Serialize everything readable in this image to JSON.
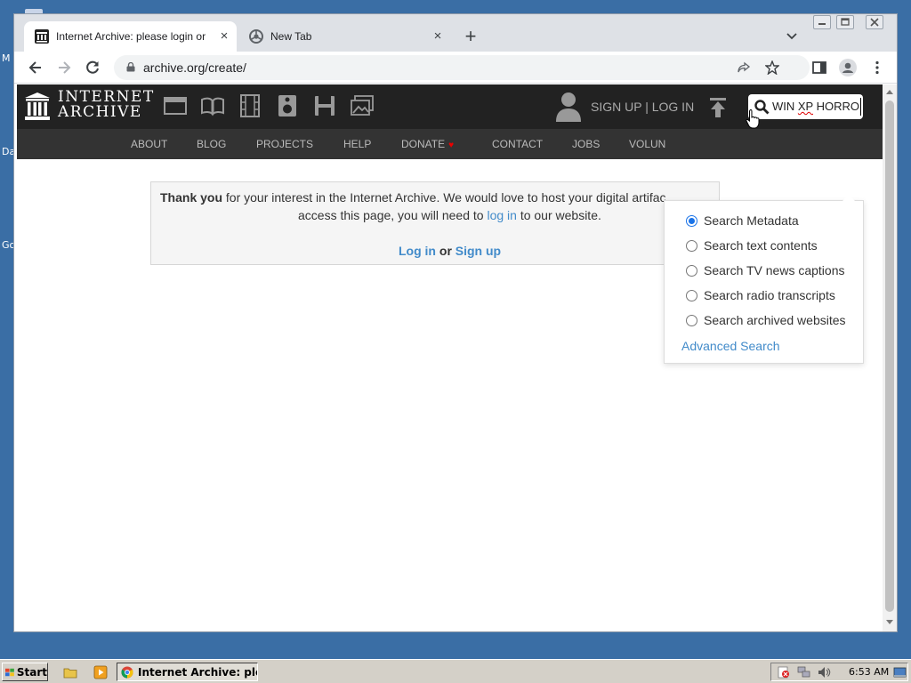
{
  "desktop": {
    "fragments": [
      "M",
      "Da",
      "Go"
    ]
  },
  "window": {
    "controls": [
      "minimize-icon",
      "maximize-icon",
      "close-icon"
    ],
    "tabs": [
      {
        "title": "Internet Archive: please login or ",
        "close": "×",
        "active": true
      },
      {
        "title": "New Tab",
        "close": "×",
        "active": false
      }
    ],
    "newtab_label": "+",
    "toolbar": {
      "url": "archive.org/create/"
    }
  },
  "ia": {
    "logo_line1": "INTERNET",
    "logo_line2": "ARCHIVE",
    "media_icons": [
      "web-icon",
      "texts-icon",
      "video-icon",
      "audio-icon",
      "software-icon",
      "images-icon"
    ],
    "auth": "SIGN UP | LOG IN",
    "search_value": "WIN XP HORRO",
    "search_value_prefix": "WIN ",
    "search_value_misspelled": "XP",
    "search_value_suffix": " HORRO",
    "nav": [
      "ABOUT",
      "BLOG",
      "PROJECTS",
      "HELP",
      "DONATE",
      "CONTACT",
      "JOBS",
      "VOLUN"
    ],
    "donate_heart": "♥",
    "accent_color": "#428bca"
  },
  "message": {
    "line1_bold": "Thank you",
    "line1_rest": " for your interest in the Internet Archive. We would love to host your digital artifac",
    "line2_pre": "access this page, you will need to ",
    "line2_link": "log in",
    "line2_post": " to our website.",
    "login": "Log in",
    "or": " or ",
    "signup": "Sign up"
  },
  "search_dropdown": {
    "options": [
      {
        "label": "Search Metadata",
        "selected": true
      },
      {
        "label": "Search text contents",
        "selected": false
      },
      {
        "label": "Search TV news captions",
        "selected": false
      },
      {
        "label": "Search radio transcripts",
        "selected": false
      },
      {
        "label": "Search archived websites",
        "selected": false
      }
    ],
    "advanced": "Advanced Search"
  },
  "taskbar": {
    "start": "Start",
    "task": "Internet Archive: ple...",
    "clock": "6:53 AM"
  }
}
